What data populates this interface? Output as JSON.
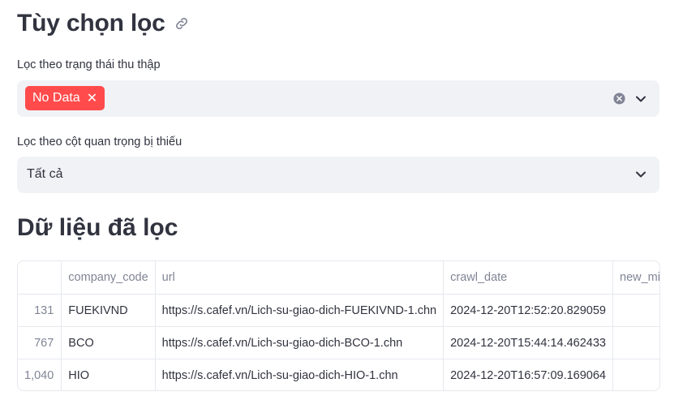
{
  "filters": {
    "title": "Tùy chọn lọc",
    "status_label": "Lọc theo trạng thái thu thập",
    "status_tags": [
      "No Data"
    ],
    "missing_label": "Lọc theo cột quan trọng bị thiếu",
    "missing_value": "Tất cả"
  },
  "data_section": {
    "title": "Dữ liệu đã lọc",
    "columns": [
      "",
      "company_code",
      "url",
      "crawl_date",
      "new_missin"
    ],
    "rows": [
      [
        "131",
        "FUEKIVND",
        "https://s.cafef.vn/Lich-su-giao-dich-FUEKIVND-1.chn",
        "2024-12-20T12:52:20.829059",
        ""
      ],
      [
        "767",
        "BCO",
        "https://s.cafef.vn/Lich-su-giao-dich-BCO-1.chn",
        "2024-12-20T15:44:14.462433",
        ""
      ],
      [
        "1,040",
        "HIO",
        "https://s.cafef.vn/Lich-su-giao-dich-HIO-1.chn",
        "2024-12-20T16:57:09.169064",
        ""
      ]
    ]
  },
  "colors": {
    "accent": "#ff4b4b",
    "field_bg": "#f0f2f6",
    "text": "#31333f",
    "muted": "#808495"
  },
  "icons": {
    "title_link": "link-icon",
    "tag_remove": "close-icon",
    "clear": "clear-icon",
    "dropdown": "chevron-down-icon"
  }
}
